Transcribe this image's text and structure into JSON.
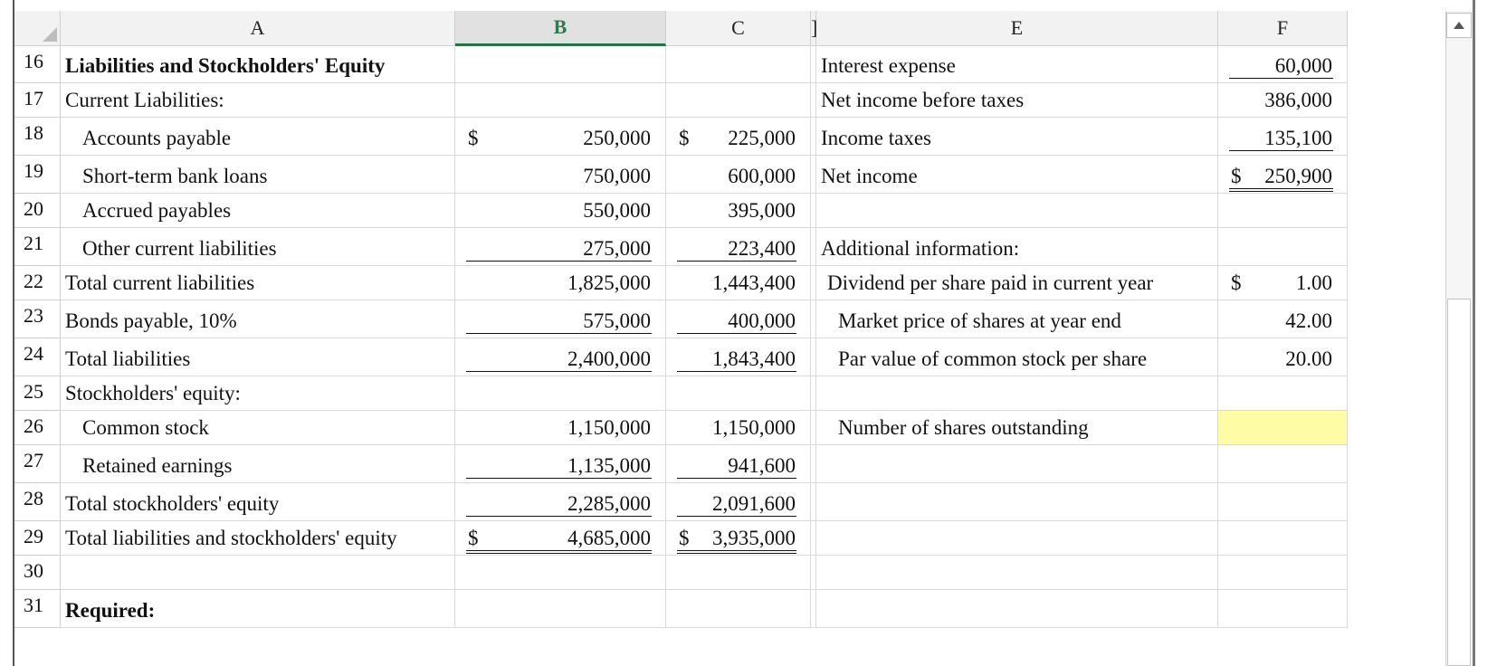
{
  "columns": [
    "A",
    "B",
    "C",
    "]",
    "E",
    "F"
  ],
  "rows": [
    {
      "n": "16",
      "A": "Liabilities and Stockholders' Equity",
      "A_bold": true,
      "B": "",
      "C": "",
      "E": "Interest expense",
      "F": "60,000"
    },
    {
      "n": "17",
      "A": "Current Liabilities:",
      "B": "",
      "C": "",
      "E": "Net income before taxes",
      "F": "386,000"
    },
    {
      "n": "18",
      "A": "Accounts payable",
      "B_cur": "$",
      "B": "250,000",
      "C_cur": "$",
      "C": "225,000",
      "E": "Income taxes",
      "F": "135,100"
    },
    {
      "n": "19",
      "A": "Short-term bank loans",
      "B": "750,000",
      "C": "600,000",
      "E": "Net income",
      "F_cur": "$",
      "F": "250,900"
    },
    {
      "n": "20",
      "A": "Accrued payables",
      "B": "550,000",
      "C": "395,000",
      "E": "",
      "F": ""
    },
    {
      "n": "21",
      "A": "Other current liabilities",
      "B": "275,000",
      "C": "223,400",
      "E": "Additional information:",
      "F": ""
    },
    {
      "n": "22",
      "A": "Total current liabilities",
      "B": "1,825,000",
      "C": "1,443,400",
      "E": "Dividend per share paid in current year",
      "F_cur": "$",
      "F": "1.00"
    },
    {
      "n": "23",
      "A": "Bonds payable, 10%",
      "B": "575,000",
      "C": "400,000",
      "E": "Market price of shares at year end",
      "F": "42.00"
    },
    {
      "n": "24",
      "A": "Total liabilities",
      "B": "2,400,000",
      "C": "1,843,400",
      "E": "Par value of common stock per share",
      "F": "20.00"
    },
    {
      "n": "25",
      "A": "Stockholders' equity:",
      "B": "",
      "C": "",
      "E": "",
      "F": ""
    },
    {
      "n": "26",
      "A": "Common stock",
      "B": "1,150,000",
      "C": "1,150,000",
      "E": "Number of shares outstanding",
      "F": ""
    },
    {
      "n": "27",
      "A": "Retained earnings",
      "B": "1,135,000",
      "C": "941,600",
      "E": "",
      "F": ""
    },
    {
      "n": "28",
      "A": "Total stockholders' equity",
      "B": "2,285,000",
      "C": "2,091,600",
      "E": "",
      "F": ""
    },
    {
      "n": "29",
      "A": "Total liabilities and stockholders' equity",
      "B_cur": "$",
      "B": "4,685,000",
      "C_cur": "$",
      "C": "3,935,000",
      "E": "",
      "F": ""
    },
    {
      "n": "30",
      "A": "",
      "B": "",
      "C": "",
      "E": "",
      "F": ""
    },
    {
      "n": "31",
      "A": "Required:",
      "A_bold": true,
      "B": "",
      "C": "",
      "E": "",
      "F": ""
    }
  ],
  "colors": {
    "selected_header_text": "#2f7a4a",
    "selected_header_border": "#217346",
    "highlight_cell": "#fefca4",
    "gridline": "#d9d9d9"
  },
  "icons": {
    "corner": "select-all-triangle-icon",
    "scroll_up": "scroll-up-arrow-icon"
  }
}
